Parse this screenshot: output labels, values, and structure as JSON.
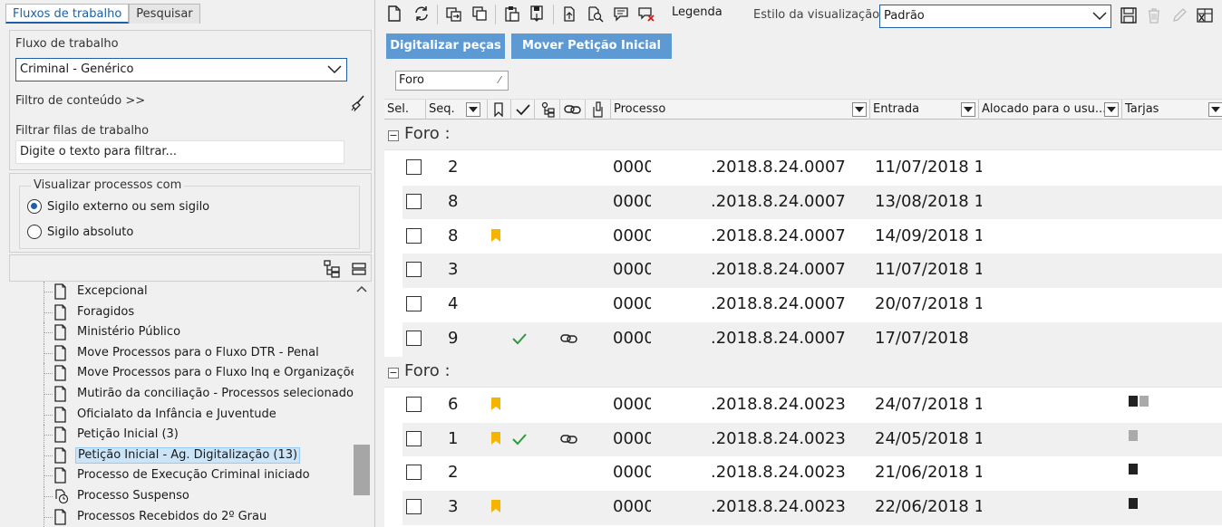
{
  "left": {
    "tabs": [
      "Fluxos de trabalho",
      "Pesquisar"
    ],
    "workflow_label": "Fluxo de trabalho",
    "workflow_value": "Criminal - Genérico",
    "content_filter": "Filtro de conteúdo >>",
    "queue_filter_label": "Filtrar filas de trabalho",
    "queue_filter_placeholder": "Digite o texto para filtrar...",
    "visualize_label": "Visualizar processos com",
    "radio_options": [
      "Sigilo externo ou sem sigilo",
      "Sigilo absoluto"
    ],
    "tree_items": [
      "Excepcional",
      "Foragidos",
      "Ministério Público",
      "Move Processos para o Fluxo DTR - Penal",
      "Move Processos para o Fluxo Inq e Organizações",
      "Mutirão da conciliação - Processos selecionados",
      "Oficialato da Infância e Juventude",
      "Petição Inicial (3)",
      "Petição Inicial - Ag. Digitalização (13)",
      "Processo de Execução Criminal iniciado",
      "Processo Suspenso",
      "Processos Recebidos do 2º Grau"
    ]
  },
  "right": {
    "legend_label": "Legenda",
    "style_label": "Estilo da visualização",
    "style_value": "Padrão",
    "action_buttons": [
      "Digitalizar peças",
      "Mover Petição Inicial"
    ],
    "group_chip": "Foro",
    "columns": [
      "Sel.",
      "Seq.",
      "Processo",
      "Entrada",
      "Alocado para o usu...",
      "Tarjas"
    ],
    "groups": [
      {
        "label": "Foro :",
        "rows": [
          {
            "seq": "2",
            "proc1": "0000",
            "proc2": ".2018.8.24.0007",
            "entrada": "11/07/2018 1"
          },
          {
            "seq": "8",
            "proc1": "0000",
            "proc2": ".2018.8.24.0007",
            "entrada": "13/08/2018 1"
          },
          {
            "seq": "8",
            "proc1": "0000",
            "proc2": ".2018.8.24.0007",
            "entrada": "14/09/2018 1"
          },
          {
            "seq": "3",
            "proc1": "0000",
            "proc2": ".2018.8.24.0007",
            "entrada": "11/07/2018 1"
          },
          {
            "seq": "4",
            "proc1": "0000",
            "proc2": ".2018.8.24.0007",
            "entrada": "20/07/2018 1"
          },
          {
            "seq": "9",
            "proc1": "0000",
            "proc2": ".2018.8.24.0007",
            "entrada": "17/07/2018"
          }
        ]
      },
      {
        "label": "Foro :",
        "rows": [
          {
            "seq": "6",
            "proc1": "0000",
            "proc2": ".2018.8.24.0023",
            "entrada": "24/07/2018 1"
          },
          {
            "seq": "1",
            "proc1": "0000",
            "proc2": ".2018.8.24.0023",
            "entrada": "24/05/2018 1"
          },
          {
            "seq": "2",
            "proc1": "0000",
            "proc2": ".2018.8.24.0023",
            "entrada": "21/06/2018 1"
          },
          {
            "seq": "3",
            "proc1": "0000",
            "proc2": ".2018.8.24.0023",
            "entrada": "22/06/2018 1"
          }
        ]
      }
    ]
  },
  "colors": {
    "accent": "#1e5fa8",
    "button": "#5d9ad4",
    "flag": "#f5b400",
    "check": "#2e9a3e"
  }
}
